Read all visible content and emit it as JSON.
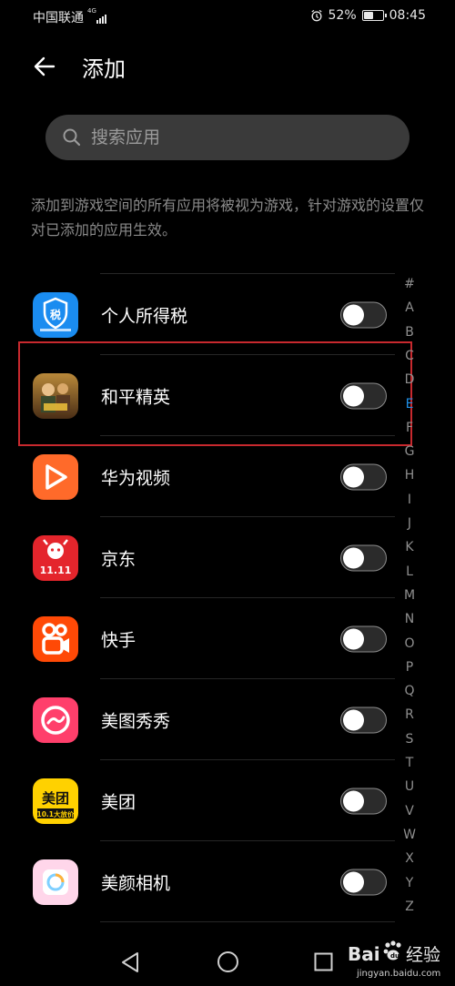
{
  "status_bar": {
    "carrier": "中国联通",
    "network": "4G",
    "battery": "52%",
    "battery_level": 0.52,
    "time": "08:45",
    "icons": [
      "signal-icon",
      "alarm-icon",
      "battery-icon"
    ]
  },
  "header": {
    "back_icon": "arrow-left-icon",
    "title": "添加"
  },
  "search": {
    "icon": "search-icon",
    "placeholder": "搜索应用"
  },
  "description": "添加到游戏空间的所有应用将被视为游戏，针对游戏的设置仅对已添加的应用生效。",
  "apps": [
    {
      "name": "个人所得税",
      "icon": "tax-app-icon",
      "enabled": false
    },
    {
      "name": "和平精英",
      "icon": "game-app-icon",
      "enabled": false
    },
    {
      "name": "华为视频",
      "icon": "video-app-icon",
      "enabled": false
    },
    {
      "name": "京东",
      "icon": "jd-app-icon",
      "enabled": false
    },
    {
      "name": "快手",
      "icon": "kuaishou-app-icon",
      "enabled": false
    },
    {
      "name": "美图秀秀",
      "icon": "meitu-app-icon",
      "enabled": false
    },
    {
      "name": "美团",
      "icon": "meituan-app-icon",
      "enabled": false
    },
    {
      "name": "美颜相机",
      "icon": "beauty-camera-app-icon",
      "enabled": false
    }
  ],
  "app_icon_text": {
    "tax": "税",
    "meituan": "美团",
    "meituan_sub": "10.1大放价",
    "jd": "11.11"
  },
  "alphabet_index": {
    "letters": [
      "#",
      "A",
      "B",
      "C",
      "D",
      "E",
      "F",
      "G",
      "H",
      "I",
      "J",
      "K",
      "L",
      "M",
      "N",
      "O",
      "P",
      "Q",
      "R",
      "S",
      "T",
      "U",
      "V",
      "W",
      "X",
      "Y",
      "Z"
    ],
    "active": "E"
  },
  "nav_bar": {
    "icons": [
      "nav-back-icon",
      "nav-home-icon",
      "nav-recent-icon"
    ]
  },
  "watermark": {
    "logo_text": "Baidu经验",
    "url": "jingyan.baidu.com"
  },
  "colors": {
    "background": "#000000",
    "highlight_box": "#c8292e",
    "alpha_active": "#1f8fe5",
    "search_bg": "#3a3a3a"
  }
}
